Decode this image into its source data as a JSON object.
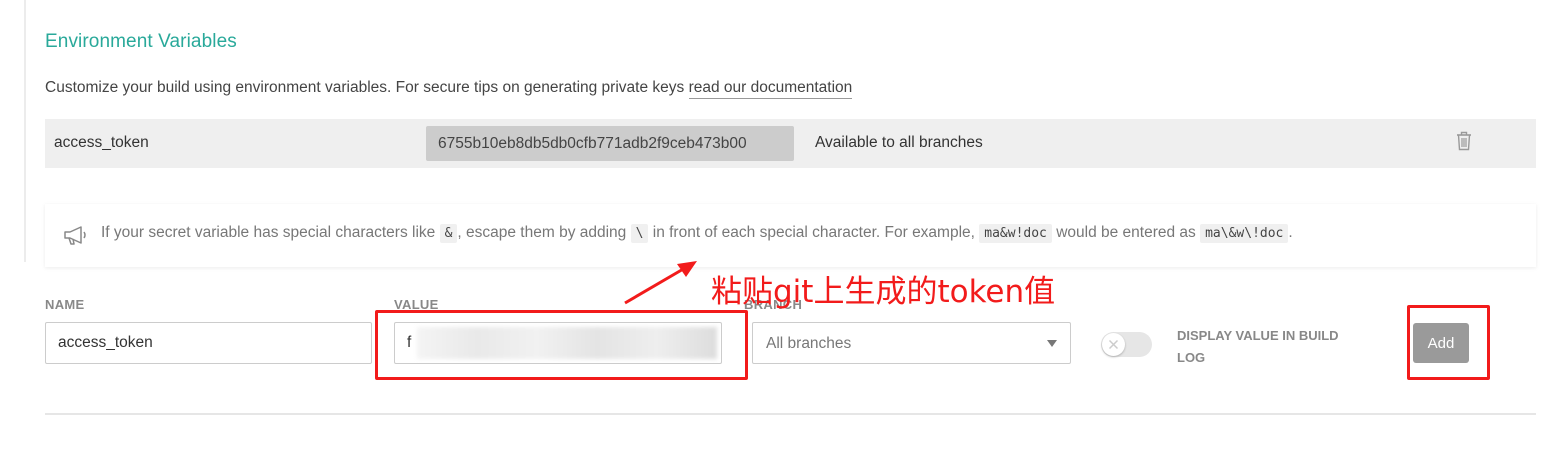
{
  "section": {
    "title": "Environment Variables",
    "description": "Customize your build using environment variables. For secure tips on generating private keys ",
    "doc_link": "read our documentation"
  },
  "existing_variable": {
    "name": "access_token",
    "value": "6755b10eb8db5db0cfb771adb2f9ceb473b00",
    "branches": "Available to all branches",
    "delete_icon": "trash-icon"
  },
  "notice": {
    "icon": "megaphone-icon",
    "text_1": "If your secret variable has special characters like ",
    "code_1": "&",
    "text_2": ", escape them by adding ",
    "code_2": "\\",
    "text_3": " in front of each special character. For example, ",
    "code_3": "ma&w!doc",
    "text_4": " would be entered as ",
    "code_4": "ma\\&w\\!doc",
    "text_5": "."
  },
  "form": {
    "name_label": "NAME",
    "name_value": "access_token",
    "value_label": "VALUE",
    "value_value": "f",
    "branch_label": "BRANCH",
    "branch_selected": "All branches",
    "display_label": "DISPLAY VALUE IN BUILD LOG",
    "display_toggle": "off",
    "add_label": "Add"
  },
  "annotation": {
    "text": "粘贴git上生成的token值",
    "color": "#f21b1b"
  },
  "colors": {
    "accent": "#29a99a",
    "row_background": "#efefef",
    "button_disabled": "#9a9a9a"
  }
}
